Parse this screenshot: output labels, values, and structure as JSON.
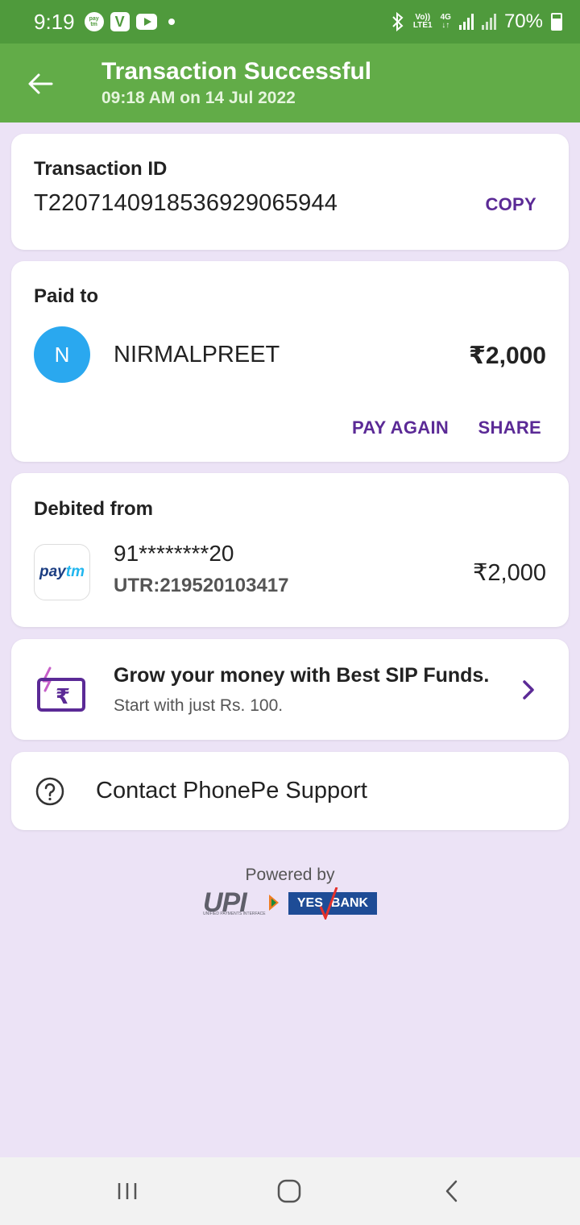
{
  "status_bar": {
    "time": "9:19",
    "left_icons": [
      "paytm-icon",
      "v-app-icon",
      "youtube-icon",
      "notification-dot"
    ],
    "network_top": "Vo))",
    "network_bottom": "LTE1",
    "data_type": "4G",
    "battery": "70%"
  },
  "header": {
    "title": "Transaction Successful",
    "subtitle": "09:18 AM on 14 Jul 2022",
    "accent_color": "#62ac48"
  },
  "transaction": {
    "label": "Transaction ID",
    "id": "T2207140918536929065944",
    "copy_label": "COPY"
  },
  "paid_to": {
    "label": "Paid to",
    "avatar_initial": "N",
    "name": "NIRMALPREET",
    "amount": "₹2,000",
    "pay_again_label": "PAY AGAIN",
    "share_label": "SHARE"
  },
  "debited_from": {
    "label": "Debited from",
    "logo_pay": "pay",
    "logo_tm": "tm",
    "account": "91********20",
    "utr": "UTR:219520103417",
    "amount": "₹2,000"
  },
  "promo": {
    "title": "Grow your money with Best SIP Funds.",
    "subtitle": "Start with just Rs. 100."
  },
  "support": {
    "label": "Contact PhonePe Support"
  },
  "footer": {
    "powered_by": "Powered by",
    "upi_text": "UPI",
    "upi_tagline": "UNIFIED PAYMENTS INTERFACE",
    "bank_left": "YES",
    "bank_right": "BANK"
  },
  "colors": {
    "link_purple": "#5b2a96",
    "background": "#ece3f6",
    "avatar_blue": "#2aa8ef"
  }
}
